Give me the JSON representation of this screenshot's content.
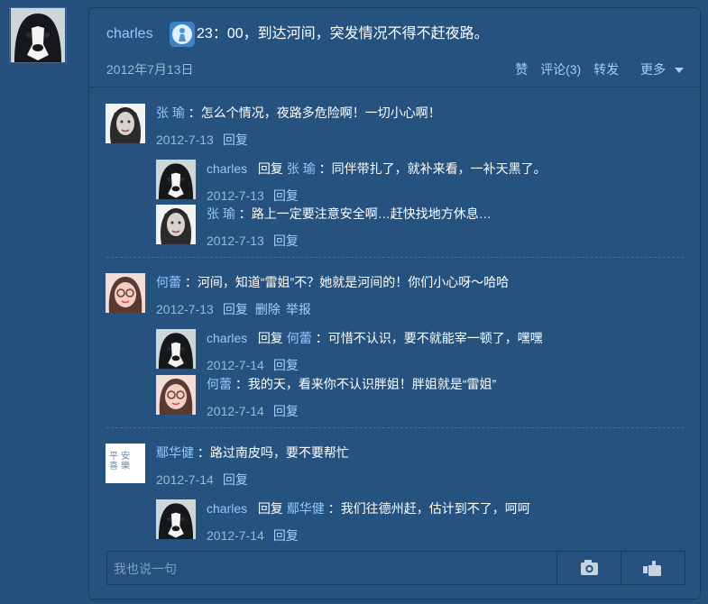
{
  "post": {
    "author": "charles",
    "content": "23：00，到达河间，突发情况不得不赶夜路。",
    "date": "2012年7月13日",
    "actions": {
      "like": "赞",
      "comment": "评论(3)",
      "repost": "转发",
      "more": "更多"
    }
  },
  "comments": [
    {
      "name": "张 瑜",
      "text": "：怎么个情况，夜路多危险啊！一切小心啊！",
      "date": "2012-7-13",
      "actions": [
        "回复"
      ],
      "replies": [
        {
          "name": "charles",
          "reply_word": "回复",
          "reply_to": "张 瑜",
          "text": "：同伴带扎了，就补来看，一补天黑了。",
          "date": "2012-7-13",
          "action": "回复"
        },
        {
          "name": "张 瑜",
          "text": "：路上一定要注意安全啊…赶快找地方休息…",
          "date": "2012-7-13",
          "action": "回复"
        }
      ]
    },
    {
      "name": "何蕾",
      "text": "：河间，知道“雷姐”不？她就是河间的！你们小心呀～哈哈",
      "date": "2012-7-13",
      "actions": [
        "回复",
        "删除",
        "举报"
      ],
      "replies": [
        {
          "name": "charles",
          "reply_word": "回复",
          "reply_to": "何蕾",
          "text": "：可惜不认识，要不就能宰一顿了，嘿嘿",
          "date": "2012-7-14",
          "action": "回复"
        },
        {
          "name": "何蕾",
          "text": "：我的天，看来你不认识胖姐！胖姐就是“雷姐”",
          "date": "2012-7-14",
          "action": "回复"
        }
      ]
    },
    {
      "name": "鄢华健",
      "text": "：路过南皮吗，要不要帮忙",
      "date": "2012-7-14",
      "actions": [
        "回复"
      ],
      "avatar_text": [
        "平 安",
        "喜 樂"
      ],
      "replies": [
        {
          "name": "charles",
          "reply_word": "回复",
          "reply_to": "鄢华健",
          "text": "：我们往德州赶，估计到不了，呵呵",
          "date": "2012-7-14",
          "action": "回复"
        }
      ]
    }
  ],
  "input": {
    "placeholder": "我也说一句"
  },
  "icons": {
    "camera": "camera-icon",
    "hand": "hand-point-icon",
    "medal": "medal-icon"
  }
}
